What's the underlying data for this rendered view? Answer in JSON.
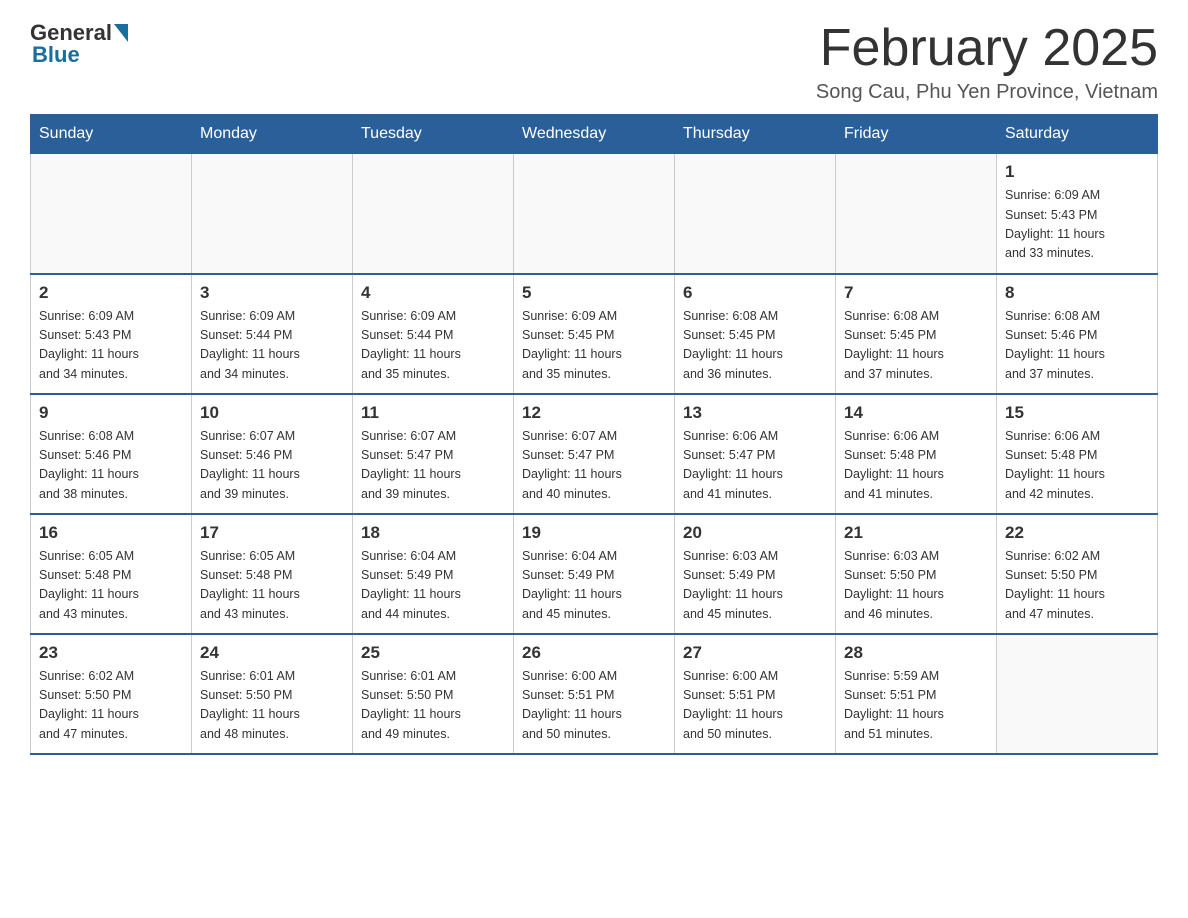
{
  "header": {
    "logo_general": "General",
    "logo_blue": "Blue",
    "month_title": "February 2025",
    "location": "Song Cau, Phu Yen Province, Vietnam"
  },
  "days_of_week": [
    "Sunday",
    "Monday",
    "Tuesday",
    "Wednesday",
    "Thursday",
    "Friday",
    "Saturday"
  ],
  "weeks": [
    [
      {
        "day": "",
        "info": ""
      },
      {
        "day": "",
        "info": ""
      },
      {
        "day": "",
        "info": ""
      },
      {
        "day": "",
        "info": ""
      },
      {
        "day": "",
        "info": ""
      },
      {
        "day": "",
        "info": ""
      },
      {
        "day": "1",
        "info": "Sunrise: 6:09 AM\nSunset: 5:43 PM\nDaylight: 11 hours\nand 33 minutes."
      }
    ],
    [
      {
        "day": "2",
        "info": "Sunrise: 6:09 AM\nSunset: 5:43 PM\nDaylight: 11 hours\nand 34 minutes."
      },
      {
        "day": "3",
        "info": "Sunrise: 6:09 AM\nSunset: 5:44 PM\nDaylight: 11 hours\nand 34 minutes."
      },
      {
        "day": "4",
        "info": "Sunrise: 6:09 AM\nSunset: 5:44 PM\nDaylight: 11 hours\nand 35 minutes."
      },
      {
        "day": "5",
        "info": "Sunrise: 6:09 AM\nSunset: 5:45 PM\nDaylight: 11 hours\nand 35 minutes."
      },
      {
        "day": "6",
        "info": "Sunrise: 6:08 AM\nSunset: 5:45 PM\nDaylight: 11 hours\nand 36 minutes."
      },
      {
        "day": "7",
        "info": "Sunrise: 6:08 AM\nSunset: 5:45 PM\nDaylight: 11 hours\nand 37 minutes."
      },
      {
        "day": "8",
        "info": "Sunrise: 6:08 AM\nSunset: 5:46 PM\nDaylight: 11 hours\nand 37 minutes."
      }
    ],
    [
      {
        "day": "9",
        "info": "Sunrise: 6:08 AM\nSunset: 5:46 PM\nDaylight: 11 hours\nand 38 minutes."
      },
      {
        "day": "10",
        "info": "Sunrise: 6:07 AM\nSunset: 5:46 PM\nDaylight: 11 hours\nand 39 minutes."
      },
      {
        "day": "11",
        "info": "Sunrise: 6:07 AM\nSunset: 5:47 PM\nDaylight: 11 hours\nand 39 minutes."
      },
      {
        "day": "12",
        "info": "Sunrise: 6:07 AM\nSunset: 5:47 PM\nDaylight: 11 hours\nand 40 minutes."
      },
      {
        "day": "13",
        "info": "Sunrise: 6:06 AM\nSunset: 5:47 PM\nDaylight: 11 hours\nand 41 minutes."
      },
      {
        "day": "14",
        "info": "Sunrise: 6:06 AM\nSunset: 5:48 PM\nDaylight: 11 hours\nand 41 minutes."
      },
      {
        "day": "15",
        "info": "Sunrise: 6:06 AM\nSunset: 5:48 PM\nDaylight: 11 hours\nand 42 minutes."
      }
    ],
    [
      {
        "day": "16",
        "info": "Sunrise: 6:05 AM\nSunset: 5:48 PM\nDaylight: 11 hours\nand 43 minutes."
      },
      {
        "day": "17",
        "info": "Sunrise: 6:05 AM\nSunset: 5:48 PM\nDaylight: 11 hours\nand 43 minutes."
      },
      {
        "day": "18",
        "info": "Sunrise: 6:04 AM\nSunset: 5:49 PM\nDaylight: 11 hours\nand 44 minutes."
      },
      {
        "day": "19",
        "info": "Sunrise: 6:04 AM\nSunset: 5:49 PM\nDaylight: 11 hours\nand 45 minutes."
      },
      {
        "day": "20",
        "info": "Sunrise: 6:03 AM\nSunset: 5:49 PM\nDaylight: 11 hours\nand 45 minutes."
      },
      {
        "day": "21",
        "info": "Sunrise: 6:03 AM\nSunset: 5:50 PM\nDaylight: 11 hours\nand 46 minutes."
      },
      {
        "day": "22",
        "info": "Sunrise: 6:02 AM\nSunset: 5:50 PM\nDaylight: 11 hours\nand 47 minutes."
      }
    ],
    [
      {
        "day": "23",
        "info": "Sunrise: 6:02 AM\nSunset: 5:50 PM\nDaylight: 11 hours\nand 47 minutes."
      },
      {
        "day": "24",
        "info": "Sunrise: 6:01 AM\nSunset: 5:50 PM\nDaylight: 11 hours\nand 48 minutes."
      },
      {
        "day": "25",
        "info": "Sunrise: 6:01 AM\nSunset: 5:50 PM\nDaylight: 11 hours\nand 49 minutes."
      },
      {
        "day": "26",
        "info": "Sunrise: 6:00 AM\nSunset: 5:51 PM\nDaylight: 11 hours\nand 50 minutes."
      },
      {
        "day": "27",
        "info": "Sunrise: 6:00 AM\nSunset: 5:51 PM\nDaylight: 11 hours\nand 50 minutes."
      },
      {
        "day": "28",
        "info": "Sunrise: 5:59 AM\nSunset: 5:51 PM\nDaylight: 11 hours\nand 51 minutes."
      },
      {
        "day": "",
        "info": ""
      }
    ]
  ]
}
